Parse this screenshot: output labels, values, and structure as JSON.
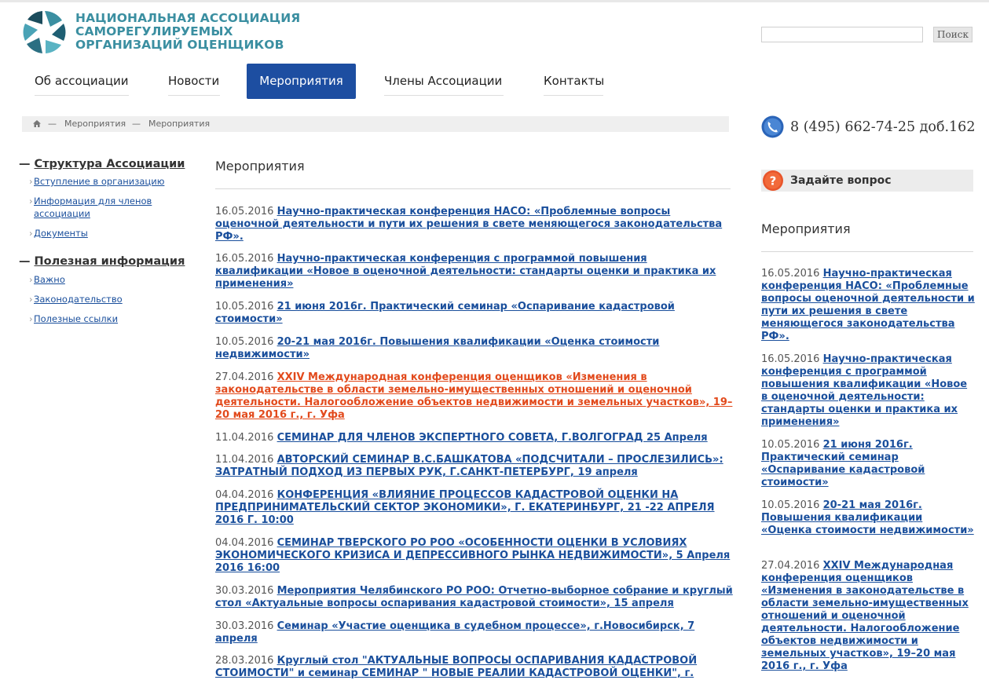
{
  "logo": {
    "line1": "НАЦИОНАЛЬНАЯ АССОЦИАЦИЯ",
    "line2": "САМОРЕГУЛИРУЕМЫХ",
    "line3": "ОРГАНИЗАЦИЙ ОЦЕНЩИКОВ"
  },
  "search": {
    "value": "",
    "button": "Поиск"
  },
  "nav": [
    {
      "label": "Об ассоциации"
    },
    {
      "label": "Новости"
    },
    {
      "label": "Мероприятия"
    },
    {
      "label": "Члены Ассоциации"
    },
    {
      "label": "Контакты"
    }
  ],
  "breadcrumb": {
    "sep": "—",
    "items": [
      "Мероприятия",
      "Мероприятия"
    ]
  },
  "phone": "8 (495) 662-74-25 доб.162",
  "ask": "Задайте вопрос",
  "left_menu": {
    "dash": "—",
    "bullet": "›",
    "sections": [
      {
        "title": "Структура Ассоциации",
        "items": [
          "Вступление в организацию",
          "Информация для членов ассоциации",
          "Документы"
        ]
      },
      {
        "title": "Полезная информация",
        "items": [
          "Важно",
          "Законодательство",
          "Полезные ссылки"
        ]
      }
    ]
  },
  "main": {
    "title": "Мероприятия",
    "entries": [
      {
        "date": "16.05.2016",
        "title": "Научно-практическая конференция НАСО: «Проблемные вопросы оценочной деятельности и пути их решения в свете меняющегося законодательства РФ»."
      },
      {
        "date": "16.05.2016",
        "title": "Научно-практическая конференция с программой повышения квалификации «Новое в оценочной деятельности: стандарты оценки и практика их применения»"
      },
      {
        "date": "10.05.2016",
        "title": "21 июня 2016г. Практический семинар «Оспаривание кадастровой стоимости»"
      },
      {
        "date": "10.05.2016",
        "title": "20-21 мая 2016г. Повышения квалификации «Оценка стоимости недвижимости»"
      },
      {
        "date": "27.04.2016",
        "title": "XXIV Международная конференция оценщиков «Изменения в законодательстве в области земельно-имущественных отношений и оценочной деятельности. Налогообложение объектов недвижимости и земельных участков», 19–20 мая 2016 г., г. Уфа"
      },
      {
        "date": "11.04.2016",
        "title": "СЕМИНАР ДЛЯ ЧЛЕНОВ ЭКСПЕРТНОГО СОВЕТА, Г.ВОЛГОГРАД 25 Апреля"
      },
      {
        "date": "11.04.2016",
        "title": "АВТОРСКИЙ СЕМИНАР В.С.БАШКАТОВА «ПОДСЧИТАЛИ – ПРОСЛЕЗИЛИСЬ»: ЗАТРАТНЫЙ ПОДХОД ИЗ ПЕРВЫХ РУК, Г.САНКТ-ПЕТЕРБУРГ, 19 апреля"
      },
      {
        "date": "04.04.2016",
        "title": "КОНФЕРЕНЦИЯ «ВЛИЯНИЕ ПРОЦЕССОВ КАДАСТРОВОЙ ОЦЕНКИ НА ПРЕДПРИНИМАТЕЛЬСКИЙ СЕКТОР ЭКОНОМИКИ», Г. ЕКАТЕРИНБУРГ, 21 -22 АПРЕЛЯ 2016 Г. 10:00"
      },
      {
        "date": "04.04.2016",
        "title": "СЕМИНАР ТВЕРСКОГО РО РОО «ОСОБЕННОСТИ ОЦЕНКИ В УСЛОВИЯХ ЭКОНОМИЧЕСКОГО КРИЗИСА И ДЕПРЕССИВНОГО РЫНКА НЕДВИЖИМОСТИ», 5 Апреля 2016 16:00"
      },
      {
        "date": "30.03.2016",
        "title": "Мероприятия Челябинского РО РОО: Отчетно-выборное собрание и круглый стол «Актуальные вопросы оспаривания кадастровой стоимости», 15 апреля"
      },
      {
        "date": "30.03.2016",
        "title": "Семинар «Участие оценщика в судебном процессе», г.Новосибирск, 7 апреля"
      },
      {
        "date": "28.03.2016",
        "title": "Круглый стол \"АКТУАЛЬНЫЕ ВОПРОСЫ ОСПАРИВАНИЯ КАДАСТРОВОЙ СТОИМОСТИ\" и семинар СЕМИНАР \" НОВЫЕ РЕАЛИИ КАДАСТРОВОЙ ОЦЕНКИ\", г."
      }
    ]
  },
  "right": {
    "title": "Мероприятия",
    "entries": [
      {
        "date": "16.05.2016",
        "title": "Научно-практическая конференция НАСО: «Проблемные вопросы оценочной деятельности и пути их решения в свете меняющегося законодательства РФ»."
      },
      {
        "date": "16.05.2016",
        "title": "Научно-практическая конференция с программой повышения квалификации «Новое в оценочной деятельности: стандарты оценки и практика их применения»"
      },
      {
        "date": "10.05.2016",
        "title": "21 июня 2016г. Практический семинар «Оспаривание кадастровой стоимости»"
      },
      {
        "date": "10.05.2016",
        "title": "20-21 мая 2016г. Повышения квалификации «Оценка стоимости недвижимости»"
      },
      {
        "date": "27.04.2016",
        "title": "XXIV Международная конференция оценщиков «Изменения в законодательстве в области земельно-имущественных отношений и оценочной деятельности. Налогообложение объектов недвижимости и земельных участков», 19–20 мая 2016 г., г. Уфа"
      }
    ]
  }
}
